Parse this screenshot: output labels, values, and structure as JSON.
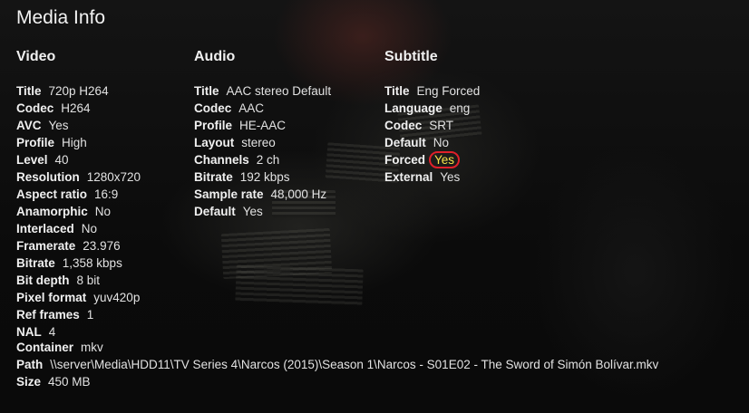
{
  "header": {
    "title": "Media Info"
  },
  "video": {
    "heading": "Video",
    "rows": [
      {
        "label": "Title",
        "value": "720p H264"
      },
      {
        "label": "Codec",
        "value": "H264"
      },
      {
        "label": "AVC",
        "value": "Yes"
      },
      {
        "label": "Profile",
        "value": "High"
      },
      {
        "label": "Level",
        "value": "40"
      },
      {
        "label": "Resolution",
        "value": "1280x720"
      },
      {
        "label": "Aspect ratio",
        "value": "16:9"
      },
      {
        "label": "Anamorphic",
        "value": "No"
      },
      {
        "label": "Interlaced",
        "value": "No"
      },
      {
        "label": "Framerate",
        "value": "23.976"
      },
      {
        "label": "Bitrate",
        "value": "1,358 kbps"
      },
      {
        "label": "Bit depth",
        "value": "8 bit"
      },
      {
        "label": "Pixel format",
        "value": "yuv420p"
      },
      {
        "label": "Ref frames",
        "value": "1"
      },
      {
        "label": "NAL",
        "value": "4"
      }
    ]
  },
  "audio": {
    "heading": "Audio",
    "rows": [
      {
        "label": "Title",
        "value": "AAC stereo Default"
      },
      {
        "label": "Codec",
        "value": "AAC"
      },
      {
        "label": "Profile",
        "value": "HE-AAC"
      },
      {
        "label": "Layout",
        "value": "stereo"
      },
      {
        "label": "Channels",
        "value": "2 ch"
      },
      {
        "label": "Bitrate",
        "value": "192 kbps"
      },
      {
        "label": "Sample rate",
        "value": "48,000 Hz"
      },
      {
        "label": "Default",
        "value": "Yes"
      }
    ]
  },
  "subtitle": {
    "heading": "Subtitle",
    "rows": [
      {
        "label": "Title",
        "value": "Eng Forced"
      },
      {
        "label": "Language",
        "value": "eng"
      },
      {
        "label": "Codec",
        "value": "SRT"
      },
      {
        "label": "Default",
        "value": "No"
      },
      {
        "label": "Forced",
        "value": "Yes"
      },
      {
        "label": "External",
        "value": "Yes"
      }
    ]
  },
  "container": {
    "label": "Container",
    "value": "mkv"
  },
  "path": {
    "label": "Path",
    "value": "\\\\server\\Media\\HDD11\\TV Series 4\\Narcos (2015)\\Season 1\\Narcos - S01E02 - The Sword of Simón Bolívar.mkv"
  },
  "size": {
    "label": "Size",
    "value": "450 MB"
  },
  "colors": {
    "highlight_text": "#f7e24a",
    "highlight_ring": "#e0202a"
  }
}
